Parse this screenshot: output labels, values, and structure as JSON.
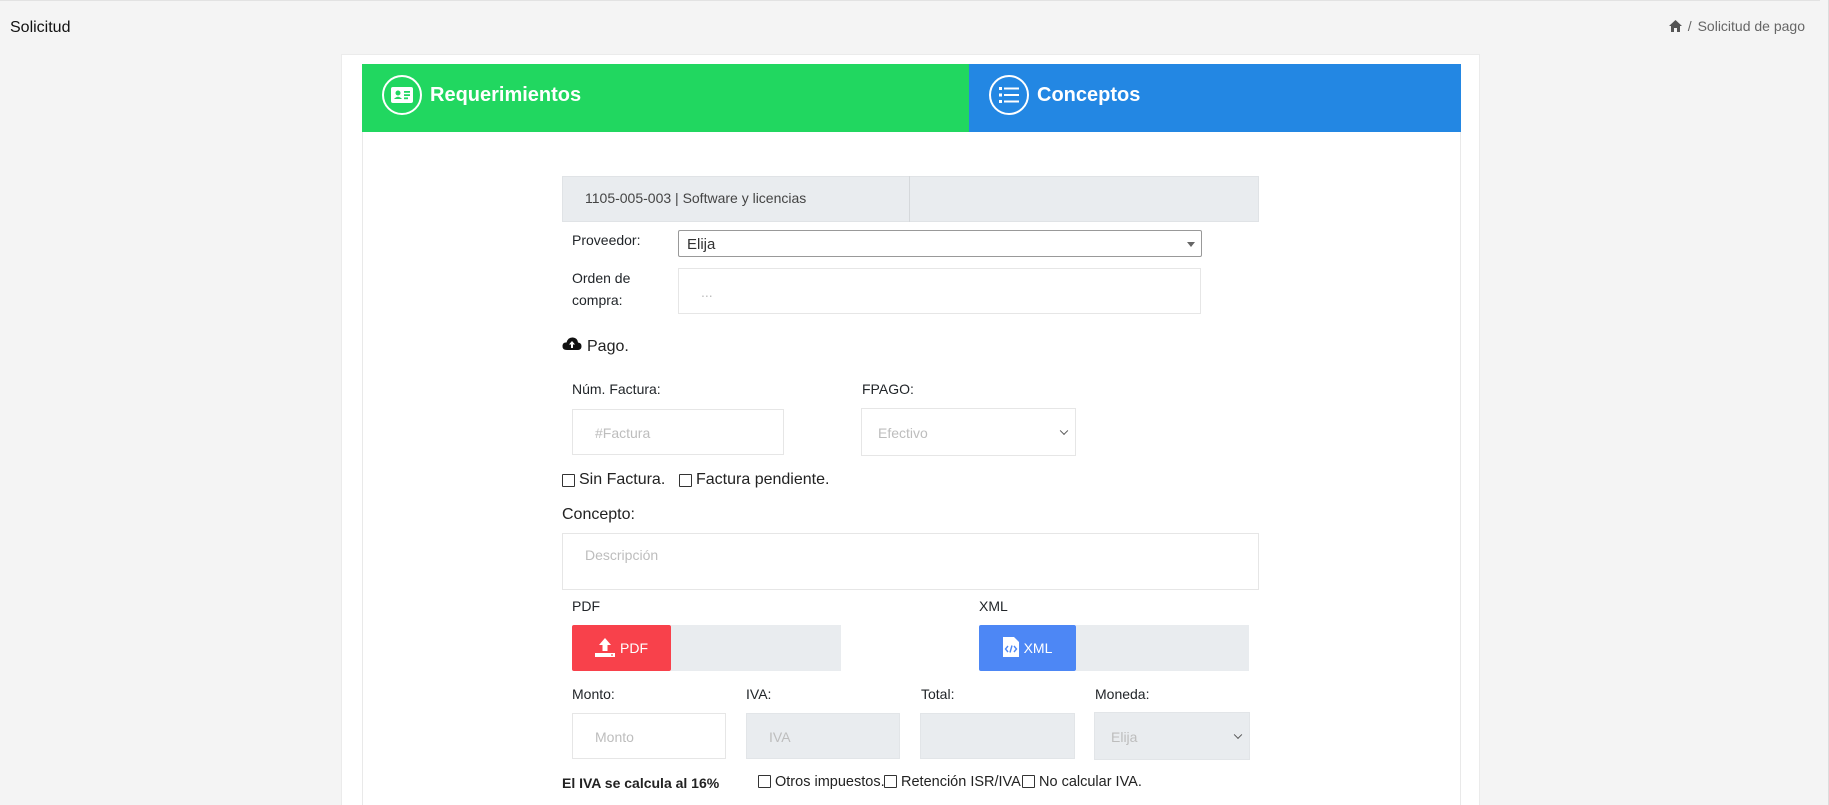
{
  "header": {
    "title": "Solicitud",
    "breadcrumb_separator": "/",
    "breadcrumb_current": "Solicitud de pago"
  },
  "tabs": [
    {
      "label": "Requerimientos",
      "icon": "id-card-icon",
      "color": "#21d760"
    },
    {
      "label": "Conceptos",
      "icon": "list-icon",
      "color": "#2387e3"
    }
  ],
  "form": {
    "cuenta": "1105-005-003 | Software y licencias",
    "proveedor_label": "Proveedor:",
    "proveedor_value": "Elija",
    "orden_label_1": "Orden de",
    "orden_label_2": "compra:",
    "orden_placeholder": "...",
    "pago_heading": "Pago.",
    "num_factura_label": "Núm. Factura:",
    "num_factura_placeholder": "#Factura",
    "fpago_label": "FPAGO:",
    "fpago_value": "Efectivo",
    "sin_factura_label": "Sin Factura.",
    "factura_pendiente_label": "Factura pendiente.",
    "concepto_label": "Concepto:",
    "concepto_placeholder": "Descripción",
    "pdf_label": "PDF",
    "pdf_button": "PDF",
    "xml_label": "XML",
    "xml_button": "XML",
    "monto_label": "Monto:",
    "monto_placeholder": "Monto",
    "iva_label": "IVA:",
    "iva_placeholder": "IVA",
    "total_label": "Total:",
    "moneda_label": "Moneda:",
    "moneda_value": "Elija",
    "iva_note": "El IVA se calcula al 16%",
    "otros_impuestos_label": "Otros impuestos.",
    "retencion_label": "Retención ISR/IVA.",
    "no_calcular_label": "No calcular IVA."
  },
  "colors": {
    "requerimientos_tab": "#21d760",
    "conceptos_tab": "#2387e3",
    "pdf_button": "#f8414b",
    "xml_button": "#4d87f5"
  }
}
